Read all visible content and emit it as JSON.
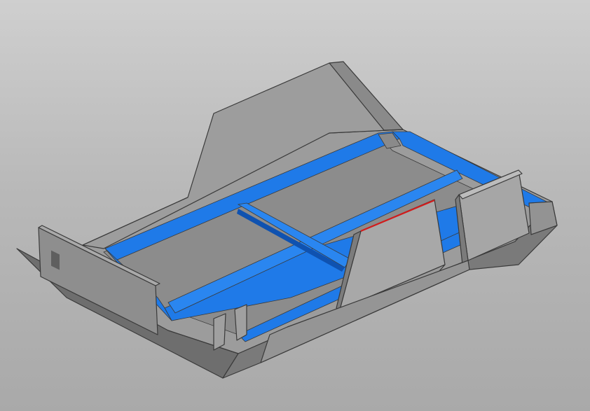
{
  "viewport": {
    "background_top": "#cfcfcf",
    "background_bottom": "#a9a9a9"
  },
  "model": {
    "kind": "3D CAD part in isometric view",
    "colors": {
      "top_face": "#a3a3a3",
      "side_face": "#7d7d7d",
      "dark_face": "#6a6a6a",
      "floor": "#8a8a8a",
      "highlight_channel": "#1f78e6",
      "highlight_channel_dark": "#0f52b0",
      "selected_edge": "#d21b1b"
    }
  }
}
